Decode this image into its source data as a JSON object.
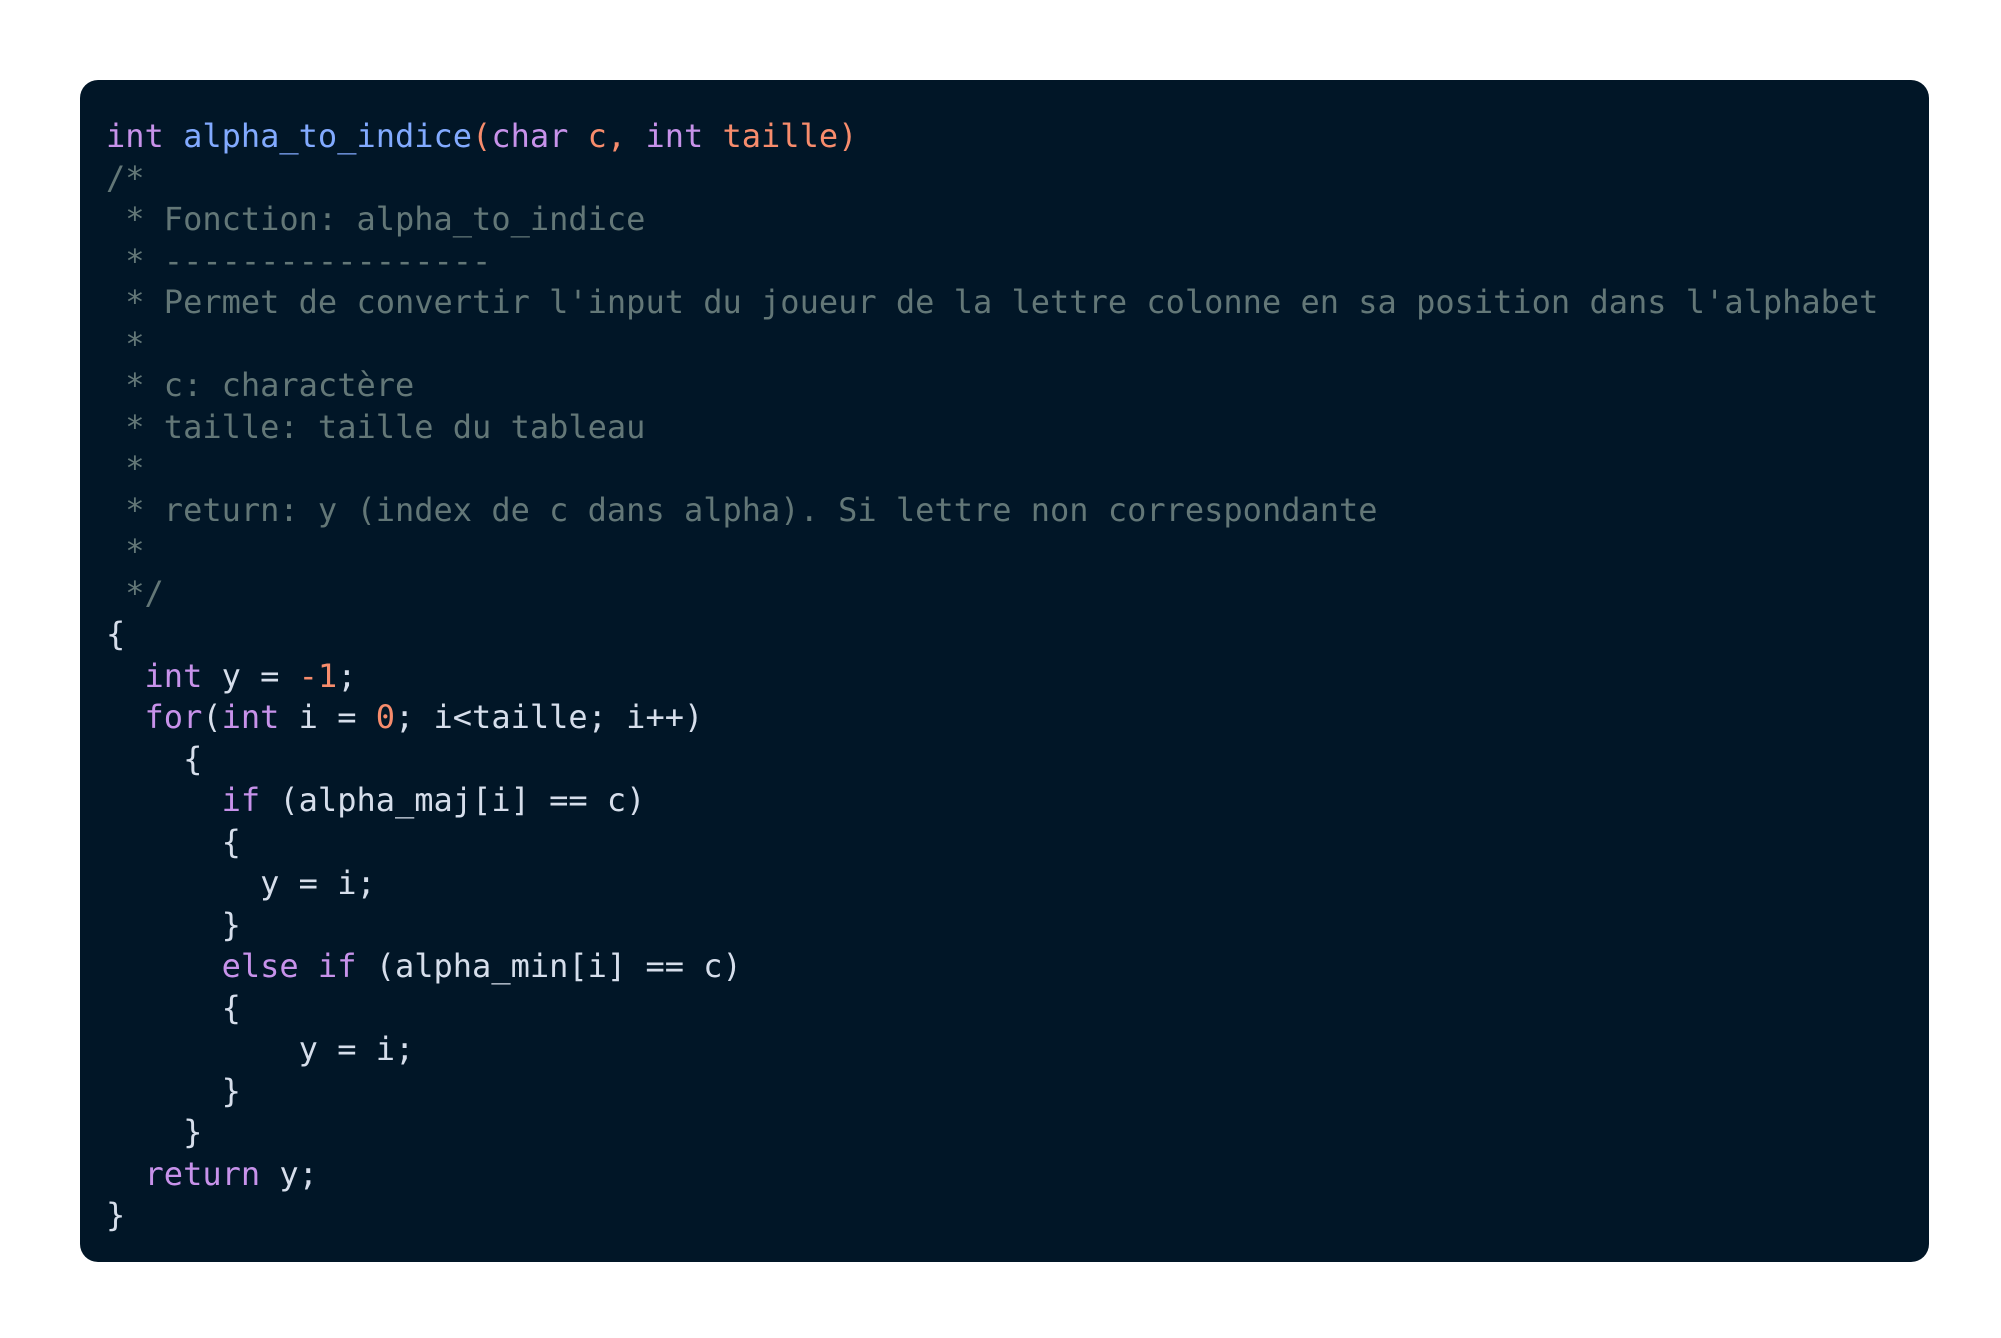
{
  "colors": {
    "page_background": "#ffffff",
    "editor_background": "#011627",
    "keyword": "#c792ea",
    "function": "#82aaff",
    "parameter": "#f78c6c",
    "number": "#f78c6c",
    "comment": "#637777",
    "plain": "#d6deeb"
  },
  "lines": [
    [
      {
        "t": "int",
        "k": "keyword"
      },
      {
        "t": " ",
        "k": "plain"
      },
      {
        "t": "alpha_to_indice",
        "k": "function"
      },
      {
        "t": "(",
        "k": "param"
      },
      {
        "t": "char",
        "k": "keyword"
      },
      {
        "t": " c, ",
        "k": "param"
      },
      {
        "t": "int",
        "k": "keyword"
      },
      {
        "t": " taille)",
        "k": "param"
      }
    ],
    [
      {
        "t": "/*",
        "k": "comment"
      }
    ],
    [
      {
        "t": " * Fonction: alpha_to_indice",
        "k": "comment"
      }
    ],
    [
      {
        "t": " * -----------------",
        "k": "comment"
      }
    ],
    [
      {
        "t": " * Permet de convertir l'input du joueur de la lettre colonne en sa position dans l'alphabet",
        "k": "comment"
      }
    ],
    [
      {
        "t": " *",
        "k": "comment"
      }
    ],
    [
      {
        "t": " * c: charactère",
        "k": "comment"
      }
    ],
    [
      {
        "t": " * taille: taille du tableau",
        "k": "comment"
      }
    ],
    [
      {
        "t": " *",
        "k": "comment"
      }
    ],
    [
      {
        "t": " * return: y (index de c dans alpha). Si lettre non correspondante",
        "k": "comment"
      }
    ],
    [
      {
        "t": " *",
        "k": "comment"
      }
    ],
    [
      {
        "t": " */",
        "k": "comment"
      }
    ],
    [
      {
        "t": "{",
        "k": "plain"
      }
    ],
    [
      {
        "t": "  ",
        "k": "plain"
      },
      {
        "t": "int",
        "k": "keyword"
      },
      {
        "t": " y = ",
        "k": "plain"
      },
      {
        "t": "-1",
        "k": "number"
      },
      {
        "t": ";",
        "k": "plain"
      }
    ],
    [
      {
        "t": "  ",
        "k": "plain"
      },
      {
        "t": "for",
        "k": "keyword"
      },
      {
        "t": "(",
        "k": "plain"
      },
      {
        "t": "int",
        "k": "keyword"
      },
      {
        "t": " i = ",
        "k": "plain"
      },
      {
        "t": "0",
        "k": "number"
      },
      {
        "t": "; i<taille; i++)",
        "k": "plain"
      }
    ],
    [
      {
        "t": "    {",
        "k": "plain"
      }
    ],
    [
      {
        "t": "      ",
        "k": "plain"
      },
      {
        "t": "if",
        "k": "keyword"
      },
      {
        "t": " (alpha_maj[i] == c)",
        "k": "plain"
      }
    ],
    [
      {
        "t": "      {",
        "k": "plain"
      }
    ],
    [
      {
        "t": "        y = i;",
        "k": "plain"
      }
    ],
    [
      {
        "t": "      }",
        "k": "plain"
      }
    ],
    [
      {
        "t": "      ",
        "k": "plain"
      },
      {
        "t": "else",
        "k": "keyword"
      },
      {
        "t": " ",
        "k": "plain"
      },
      {
        "t": "if",
        "k": "keyword"
      },
      {
        "t": " (alpha_min[i] == c)",
        "k": "plain"
      }
    ],
    [
      {
        "t": "      {",
        "k": "plain"
      }
    ],
    [
      {
        "t": "          y = i;",
        "k": "plain"
      }
    ],
    [
      {
        "t": "      }",
        "k": "plain"
      }
    ],
    [
      {
        "t": "    }",
        "k": "plain"
      }
    ],
    [
      {
        "t": "  ",
        "k": "plain"
      },
      {
        "t": "return",
        "k": "keyword"
      },
      {
        "t": " y;",
        "k": "plain"
      }
    ],
    [
      {
        "t": "}",
        "k": "plain"
      }
    ]
  ]
}
